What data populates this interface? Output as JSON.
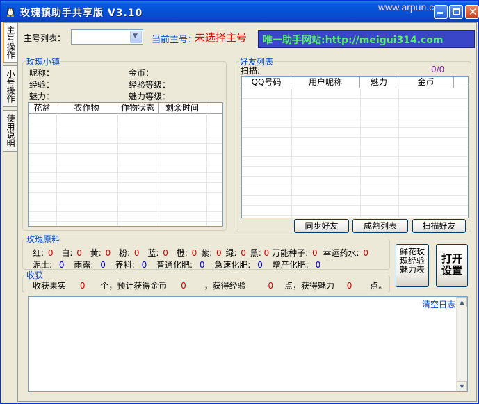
{
  "window": {
    "title": "玫瑰镇助手共享版  V3.10",
    "watermark": "www.arpun.com"
  },
  "tabs": [
    {
      "label": "主号操作"
    },
    {
      "label": "小号操作"
    },
    {
      "label": "使用说明"
    }
  ],
  "top": {
    "account_list_label": "主号列表：",
    "account_select_value": "",
    "current_main_label": "当前主号：",
    "current_main_value": "未选择主号",
    "banner_text": "唯一助手网站:http://meigui314.com"
  },
  "town": {
    "legend": "玫瑰小镇",
    "nickname_label": "昵称：",
    "gold_label": "金币：",
    "exp_label": "经验：",
    "exp_level_label": "经验等级：",
    "charm_label": "魅力：",
    "charm_level_label": "魅力等级：",
    "columns": [
      "花盆",
      "农作物",
      "作物状态",
      "剩余时间"
    ]
  },
  "friends": {
    "legend": "好友列表",
    "scan_label": "扫描:",
    "scan_count": "0/0",
    "columns": [
      "QQ号码",
      "用户昵称",
      "魅力",
      "金币"
    ],
    "sync_button": "同步好友",
    "mature_button": "成熟列表",
    "scan_button": "扫描好友"
  },
  "materials": {
    "legend": "玫瑰原料",
    "row1": [
      {
        "label": "红:",
        "value": "0"
      },
      {
        "label": "白:",
        "value": "0"
      },
      {
        "label": "黄:",
        "value": "0"
      },
      {
        "label": "粉:",
        "value": "0"
      },
      {
        "label": "蓝:",
        "value": "0"
      },
      {
        "label": "橙:",
        "value": "0"
      },
      {
        "label": "紫:",
        "value": "0"
      },
      {
        "label": "绿:",
        "value": "0"
      },
      {
        "label": "黑:",
        "value": "0"
      },
      {
        "label": "万能种子:",
        "value": "0"
      },
      {
        "label": "幸运药水:",
        "value": "0"
      }
    ],
    "row2": [
      {
        "label": "泥土:",
        "value": "0"
      },
      {
        "label": "雨露:",
        "value": "0"
      },
      {
        "label": "养料:",
        "value": "0"
      },
      {
        "label": "普通化肥:",
        "value": "0"
      },
      {
        "label": "急速化肥:",
        "value": "0"
      },
      {
        "label": "增产化肥:",
        "value": "0"
      }
    ]
  },
  "harvest": {
    "legend": "收获",
    "text1": "收获果实",
    "fruit_count": "0",
    "text2": "个，预计获得金币",
    "gold_value": "0",
    "text3": "，获得经验",
    "exp_value": "0",
    "text4": "点，获得魅力",
    "charm_value": "0",
    "text5": "点。"
  },
  "buttons": {
    "rose_charm_table": "鲜花玫瑰经验魅力表",
    "open_settings": "打开设置"
  },
  "log": {
    "clear_label": "清空日志"
  }
}
